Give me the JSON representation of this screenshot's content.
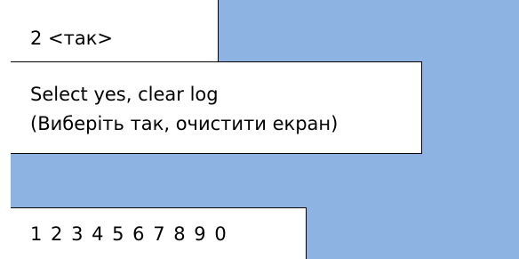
{
  "top_box": {
    "text": "2 <так>"
  },
  "middle_box": {
    "line1": "Select yes, clear log",
    "line2": "(Виберіть так, очистити екран)"
  },
  "bottom_box": {
    "text": "1 2 3 4 5 6 7 8 9 0"
  },
  "colors": {
    "background": "#8db3e2",
    "box_background": "#ffffff",
    "border": "#000000",
    "text": "#000000"
  }
}
